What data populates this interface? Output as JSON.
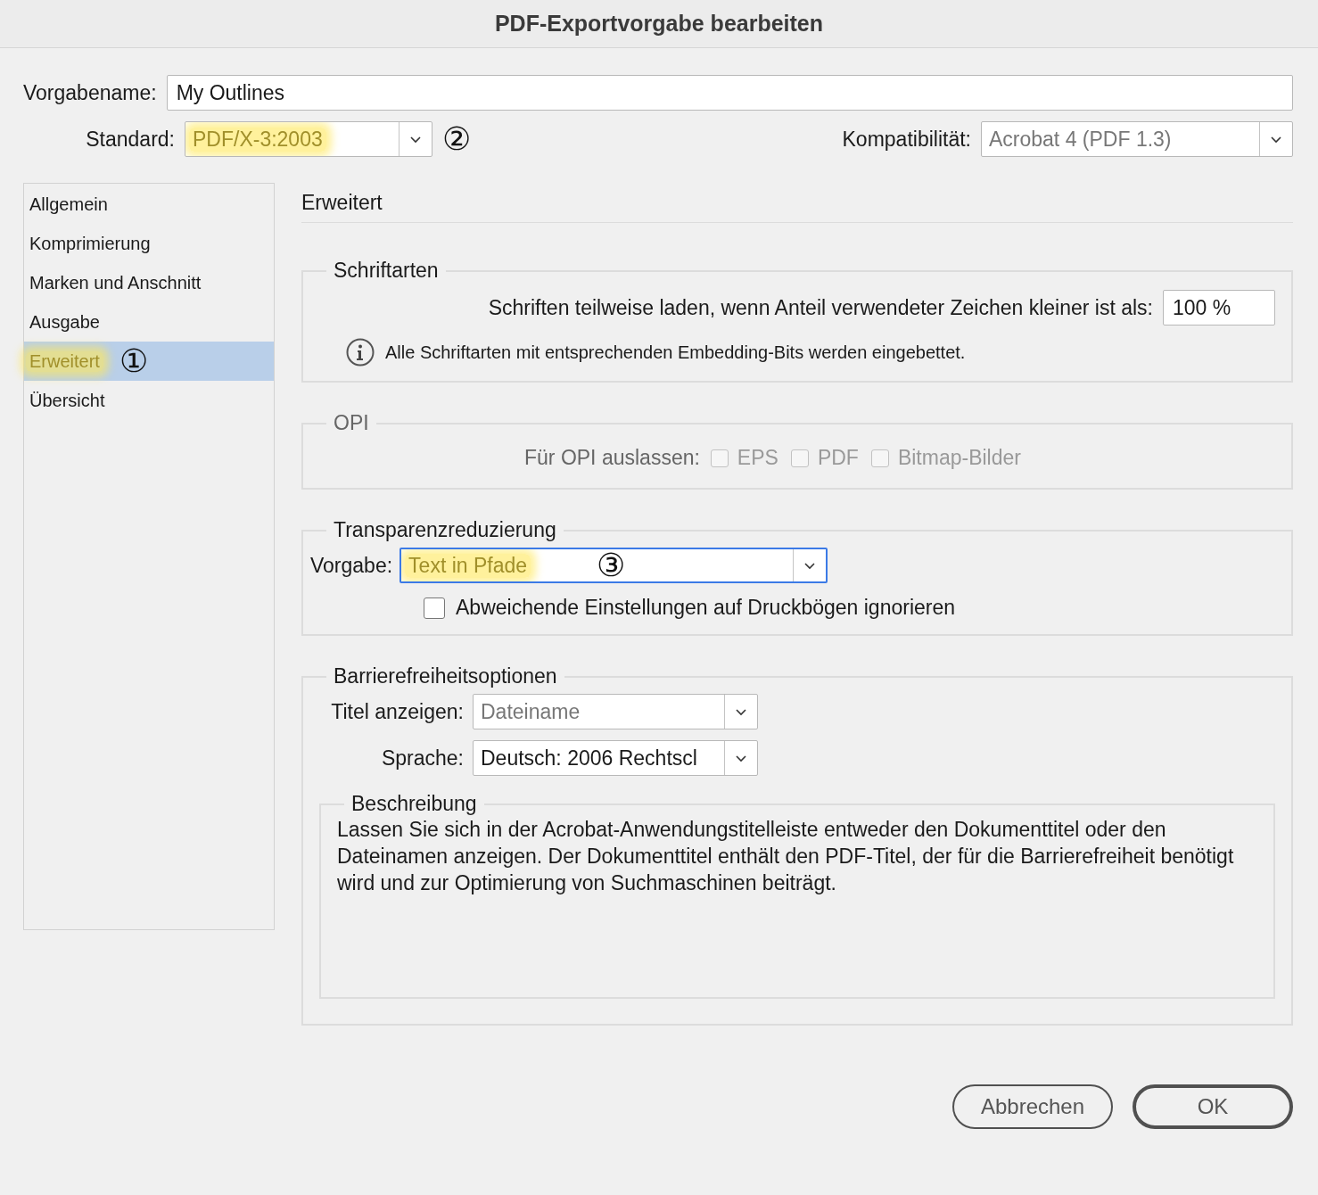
{
  "window": {
    "title": "PDF-Exportvorgabe bearbeiten"
  },
  "preset_name": {
    "label": "Vorgabename:",
    "value": "My Outlines"
  },
  "standard": {
    "label": "Standard:",
    "value": "PDF/X-3:2003",
    "highlighted": true,
    "callout": "②"
  },
  "compatibility": {
    "label": "Kompatibilität:",
    "value": "Acrobat 4 (PDF 1.3)",
    "disabled": true
  },
  "sidebar": {
    "items": [
      {
        "label": "Allgemein",
        "selected": false,
        "highlighted": false
      },
      {
        "label": "Komprimierung",
        "selected": false,
        "highlighted": false
      },
      {
        "label": "Marken und Anschnitt",
        "selected": false,
        "highlighted": false
      },
      {
        "label": "Ausgabe",
        "selected": false,
        "highlighted": false
      },
      {
        "label": "Erweitert",
        "selected": true,
        "highlighted": true,
        "callout": "①"
      },
      {
        "label": "Übersicht",
        "selected": false,
        "highlighted": false
      }
    ]
  },
  "panel": {
    "title": "Erweitert",
    "fonts": {
      "legend": "Schriftarten",
      "subset_label": "Schriften teilweise laden, wenn Anteil verwendeter Zeichen kleiner ist als:",
      "subset_value": "100 %",
      "info": "Alle Schriftarten mit entsprechenden Embedding-Bits werden eingebettet."
    },
    "opi": {
      "legend": "OPI",
      "disabled": true,
      "label": "Für OPI auslassen:",
      "options": [
        {
          "label": "EPS",
          "checked": false
        },
        {
          "label": "PDF",
          "checked": false
        },
        {
          "label": "Bitmap-Bilder",
          "checked": false
        }
      ]
    },
    "transparency": {
      "legend": "Transparenzreduzierung",
      "preset_label": "Vorgabe:",
      "preset_value": "Text in Pfade",
      "highlighted": true,
      "callout": "③",
      "focused": true,
      "ignore_overrides": {
        "label": "Abweichende Einstellungen auf Druckbögen ignorieren",
        "checked": false
      }
    },
    "accessibility": {
      "legend": "Barrierefreiheitsoptionen",
      "title_label": "Titel anzeigen:",
      "title_value": "Dateiname",
      "title_disabled": true,
      "language_label": "Sprache:",
      "language_value": "Deutsch: 2006 Rechtscl",
      "language_disabled": false,
      "description": {
        "legend": "Beschreibung",
        "text": "Lassen Sie sich in der Acrobat-Anwendungstitelleiste entweder den Dokumenttitel oder den Dateinamen anzeigen. Der Dokumenttitel enthält den PDF-Titel, der für die Barrierefreiheit benötigt wird und zur Optimierung von Suchmaschinen beiträgt."
      }
    }
  },
  "buttons": [
    {
      "label": "Abbrechen",
      "default": false
    },
    {
      "label": "OK",
      "default": true
    }
  ]
}
